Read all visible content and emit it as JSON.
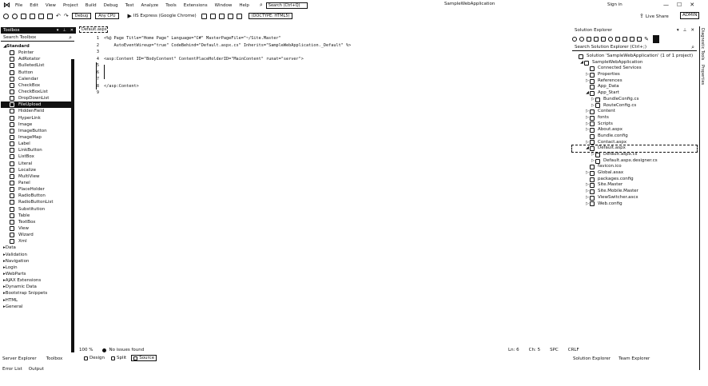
{
  "menu": {
    "items": [
      "File",
      "Edit",
      "View",
      "Project",
      "Build",
      "Debug",
      "Test",
      "Analyze",
      "Tools",
      "Extensions",
      "Window",
      "Help"
    ],
    "search_placeholder": "Search (Ctrl+Q)",
    "solution_title": "SampleWebApplication",
    "user": "Sign in",
    "window_buttons": [
      "—",
      "☐",
      "✕"
    ]
  },
  "toolbar": {
    "config": "Debug",
    "platform": "Any CPU",
    "run_target": "IIS Express (Google Chrome)",
    "doc_outline": "(DOCTYPE: HTML5)",
    "live_share": "Live Share",
    "admin": "ADMIN"
  },
  "toolbox": {
    "title": "Toolbox",
    "search_placeholder": "Search Toolbox",
    "standard_group": "Standard",
    "standard_items": [
      {
        "label": "Pointer",
        "icon": "pointer-icon"
      },
      {
        "label": "AdRotator",
        "icon": "adrotator-icon"
      },
      {
        "label": "BulletedList",
        "icon": "bulleted-list-icon"
      },
      {
        "label": "Button",
        "icon": "button-icon"
      },
      {
        "label": "Calendar",
        "icon": "calendar-icon"
      },
      {
        "label": "CheckBox",
        "icon": "checkbox-icon"
      },
      {
        "label": "CheckBoxList",
        "icon": "checkbox-list-icon"
      },
      {
        "label": "DropDownList",
        "icon": "dropdown-icon"
      },
      {
        "label": "FileUpload",
        "icon": "file-upload-icon",
        "selected": true
      },
      {
        "label": "HiddenField",
        "icon": "hidden-field-icon"
      },
      {
        "label": "HyperLink",
        "icon": "hyperlink-icon"
      },
      {
        "label": "Image",
        "icon": "image-icon"
      },
      {
        "label": "ImageButton",
        "icon": "image-button-icon"
      },
      {
        "label": "ImageMap",
        "icon": "image-map-icon"
      },
      {
        "label": "Label",
        "icon": "label-icon"
      },
      {
        "label": "LinkButton",
        "icon": "link-button-icon"
      },
      {
        "label": "ListBox",
        "icon": "listbox-icon"
      },
      {
        "label": "Literal",
        "icon": "literal-icon"
      },
      {
        "label": "Localize",
        "icon": "localize-icon"
      },
      {
        "label": "MultiView",
        "icon": "multiview-icon"
      },
      {
        "label": "Panel",
        "icon": "panel-icon"
      },
      {
        "label": "PlaceHolder",
        "icon": "placeholder-icon"
      },
      {
        "label": "RadioButton",
        "icon": "radio-button-icon"
      },
      {
        "label": "RadioButtonList",
        "icon": "radio-list-icon"
      },
      {
        "label": "Substitution",
        "icon": "substitution-icon"
      },
      {
        "label": "Table",
        "icon": "table-icon"
      },
      {
        "label": "TextBox",
        "icon": "textbox-icon"
      },
      {
        "label": "View",
        "icon": "view-icon"
      },
      {
        "label": "Wizard",
        "icon": "wizard-icon"
      },
      {
        "label": "Xml",
        "icon": "xml-icon"
      }
    ],
    "other_groups": [
      "Data",
      "Validation",
      "Navigation",
      "Login",
      "WebParts",
      "AJAX Extensions",
      "Dynamic Data",
      "Bootstrap Snippets",
      "HTML",
      "General"
    ],
    "bottom_tabs": [
      "Server Explorer",
      "Toolbox"
    ],
    "error_tabs": [
      "Error List",
      "Output"
    ]
  },
  "editor": {
    "tab_label": "Default.aspx",
    "lines": [
      {
        "num": "1",
        "code": "<%@ Page Title=\"Home Page\" Language=\"C#\" MasterPageFile=\"~/Site.Master\""
      },
      {
        "num": "2",
        "code": "    AutoEventWireup=\"true\" CodeBehind=\"Default.aspx.cs\" Inherits=\"SampleWebApplication._Default\" %>"
      },
      {
        "num": "3",
        "code": ""
      },
      {
        "num": "4",
        "code": "<asp:Content ID=\"BodyContent\" ContentPlaceHolderID=\"MainContent\" runat=\"server\">"
      },
      {
        "num": "5",
        "code": ""
      },
      {
        "num": "6",
        "code": ""
      },
      {
        "num": "7",
        "code": ""
      },
      {
        "num": "8",
        "code": "</asp:Content>"
      },
      {
        "num": "9",
        "code": ""
      }
    ],
    "zoom": "100 %",
    "issues": "No issues found",
    "status_right": [
      "Ln: 6",
      "Ch: 5",
      "SPC",
      "CRLF"
    ],
    "view_tabs": [
      {
        "label": "Design",
        "active": false
      },
      {
        "label": "Split",
        "active": false
      },
      {
        "label": "Source",
        "active": true
      }
    ]
  },
  "solution_explorer": {
    "title": "Solution Explorer",
    "search_placeholder": "Search Solution Explorer (Ctrl+;)",
    "tree": [
      {
        "indent": 0,
        "arrow": "",
        "icon": "solution-icon",
        "label": "Solution 'SampleWebApplication' (1 of 1 project)"
      },
      {
        "indent": 1,
        "arrow": "◢",
        "icon": "web-project-icon",
        "label": "SampleWebApplication"
      },
      {
        "indent": 2,
        "arrow": "",
        "icon": "connected-services-icon",
        "label": "Connected Services"
      },
      {
        "indent": 2,
        "arrow": "▷",
        "icon": "wrench-icon",
        "label": "Properties"
      },
      {
        "indent": 2,
        "arrow": "▷",
        "icon": "references-icon",
        "label": "References"
      },
      {
        "indent": 2,
        "arrow": "",
        "icon": "folder-icon",
        "label": "App_Data"
      },
      {
        "indent": 2,
        "arrow": "◢",
        "icon": "folder-icon",
        "label": "App_Start"
      },
      {
        "indent": 3,
        "arrow": "▷",
        "icon": "csharp-file-icon",
        "label": "BundleConfig.cs"
      },
      {
        "indent": 3,
        "arrow": "▷",
        "icon": "csharp-file-icon",
        "label": "RouteConfig.cs"
      },
      {
        "indent": 2,
        "arrow": "▷",
        "icon": "folder-icon",
        "label": "Content"
      },
      {
        "indent": 2,
        "arrow": "▷",
        "icon": "folder-icon",
        "label": "fonts"
      },
      {
        "indent": 2,
        "arrow": "▷",
        "icon": "folder-icon",
        "label": "Scripts"
      },
      {
        "indent": 2,
        "arrow": "▷",
        "icon": "aspx-file-icon",
        "label": "About.aspx"
      },
      {
        "indent": 2,
        "arrow": "",
        "icon": "config-file-icon",
        "label": "Bundle.config"
      },
      {
        "indent": 2,
        "arrow": "▷",
        "icon": "aspx-file-icon",
        "label": "Contact.aspx"
      },
      {
        "indent": 2,
        "arrow": "◢",
        "icon": "aspx-file-icon",
        "label": "Default.aspx",
        "selected": true
      },
      {
        "indent": 3,
        "arrow": "▷",
        "icon": "csharp-file-icon",
        "label": "Default.aspx.cs"
      },
      {
        "indent": 3,
        "arrow": "▷",
        "icon": "csharp-file-icon",
        "label": "Default.aspx.designer.cs"
      },
      {
        "indent": 2,
        "arrow": "",
        "icon": "favicon-icon",
        "label": "favicon.ico"
      },
      {
        "indent": 2,
        "arrow": "▷",
        "icon": "global-asax-icon",
        "label": "Global.asax"
      },
      {
        "indent": 2,
        "arrow": "",
        "icon": "config-file-icon",
        "label": "packages.config"
      },
      {
        "indent": 2,
        "arrow": "▷",
        "icon": "master-file-icon",
        "label": "Site.Master"
      },
      {
        "indent": 2,
        "arrow": "▷",
        "icon": "master-file-icon",
        "label": "Site.Mobile.Master"
      },
      {
        "indent": 2,
        "arrow": "▷",
        "icon": "ascx-file-icon",
        "label": "ViewSwitcher.ascx"
      },
      {
        "indent": 2,
        "arrow": "▷",
        "icon": "config-file-icon",
        "label": "Web.config"
      }
    ],
    "bottom_tabs": [
      "Solution Explorer",
      "Team Explorer"
    ],
    "vertical_tabs": [
      "Diagnostic Tools",
      "Properties"
    ]
  }
}
